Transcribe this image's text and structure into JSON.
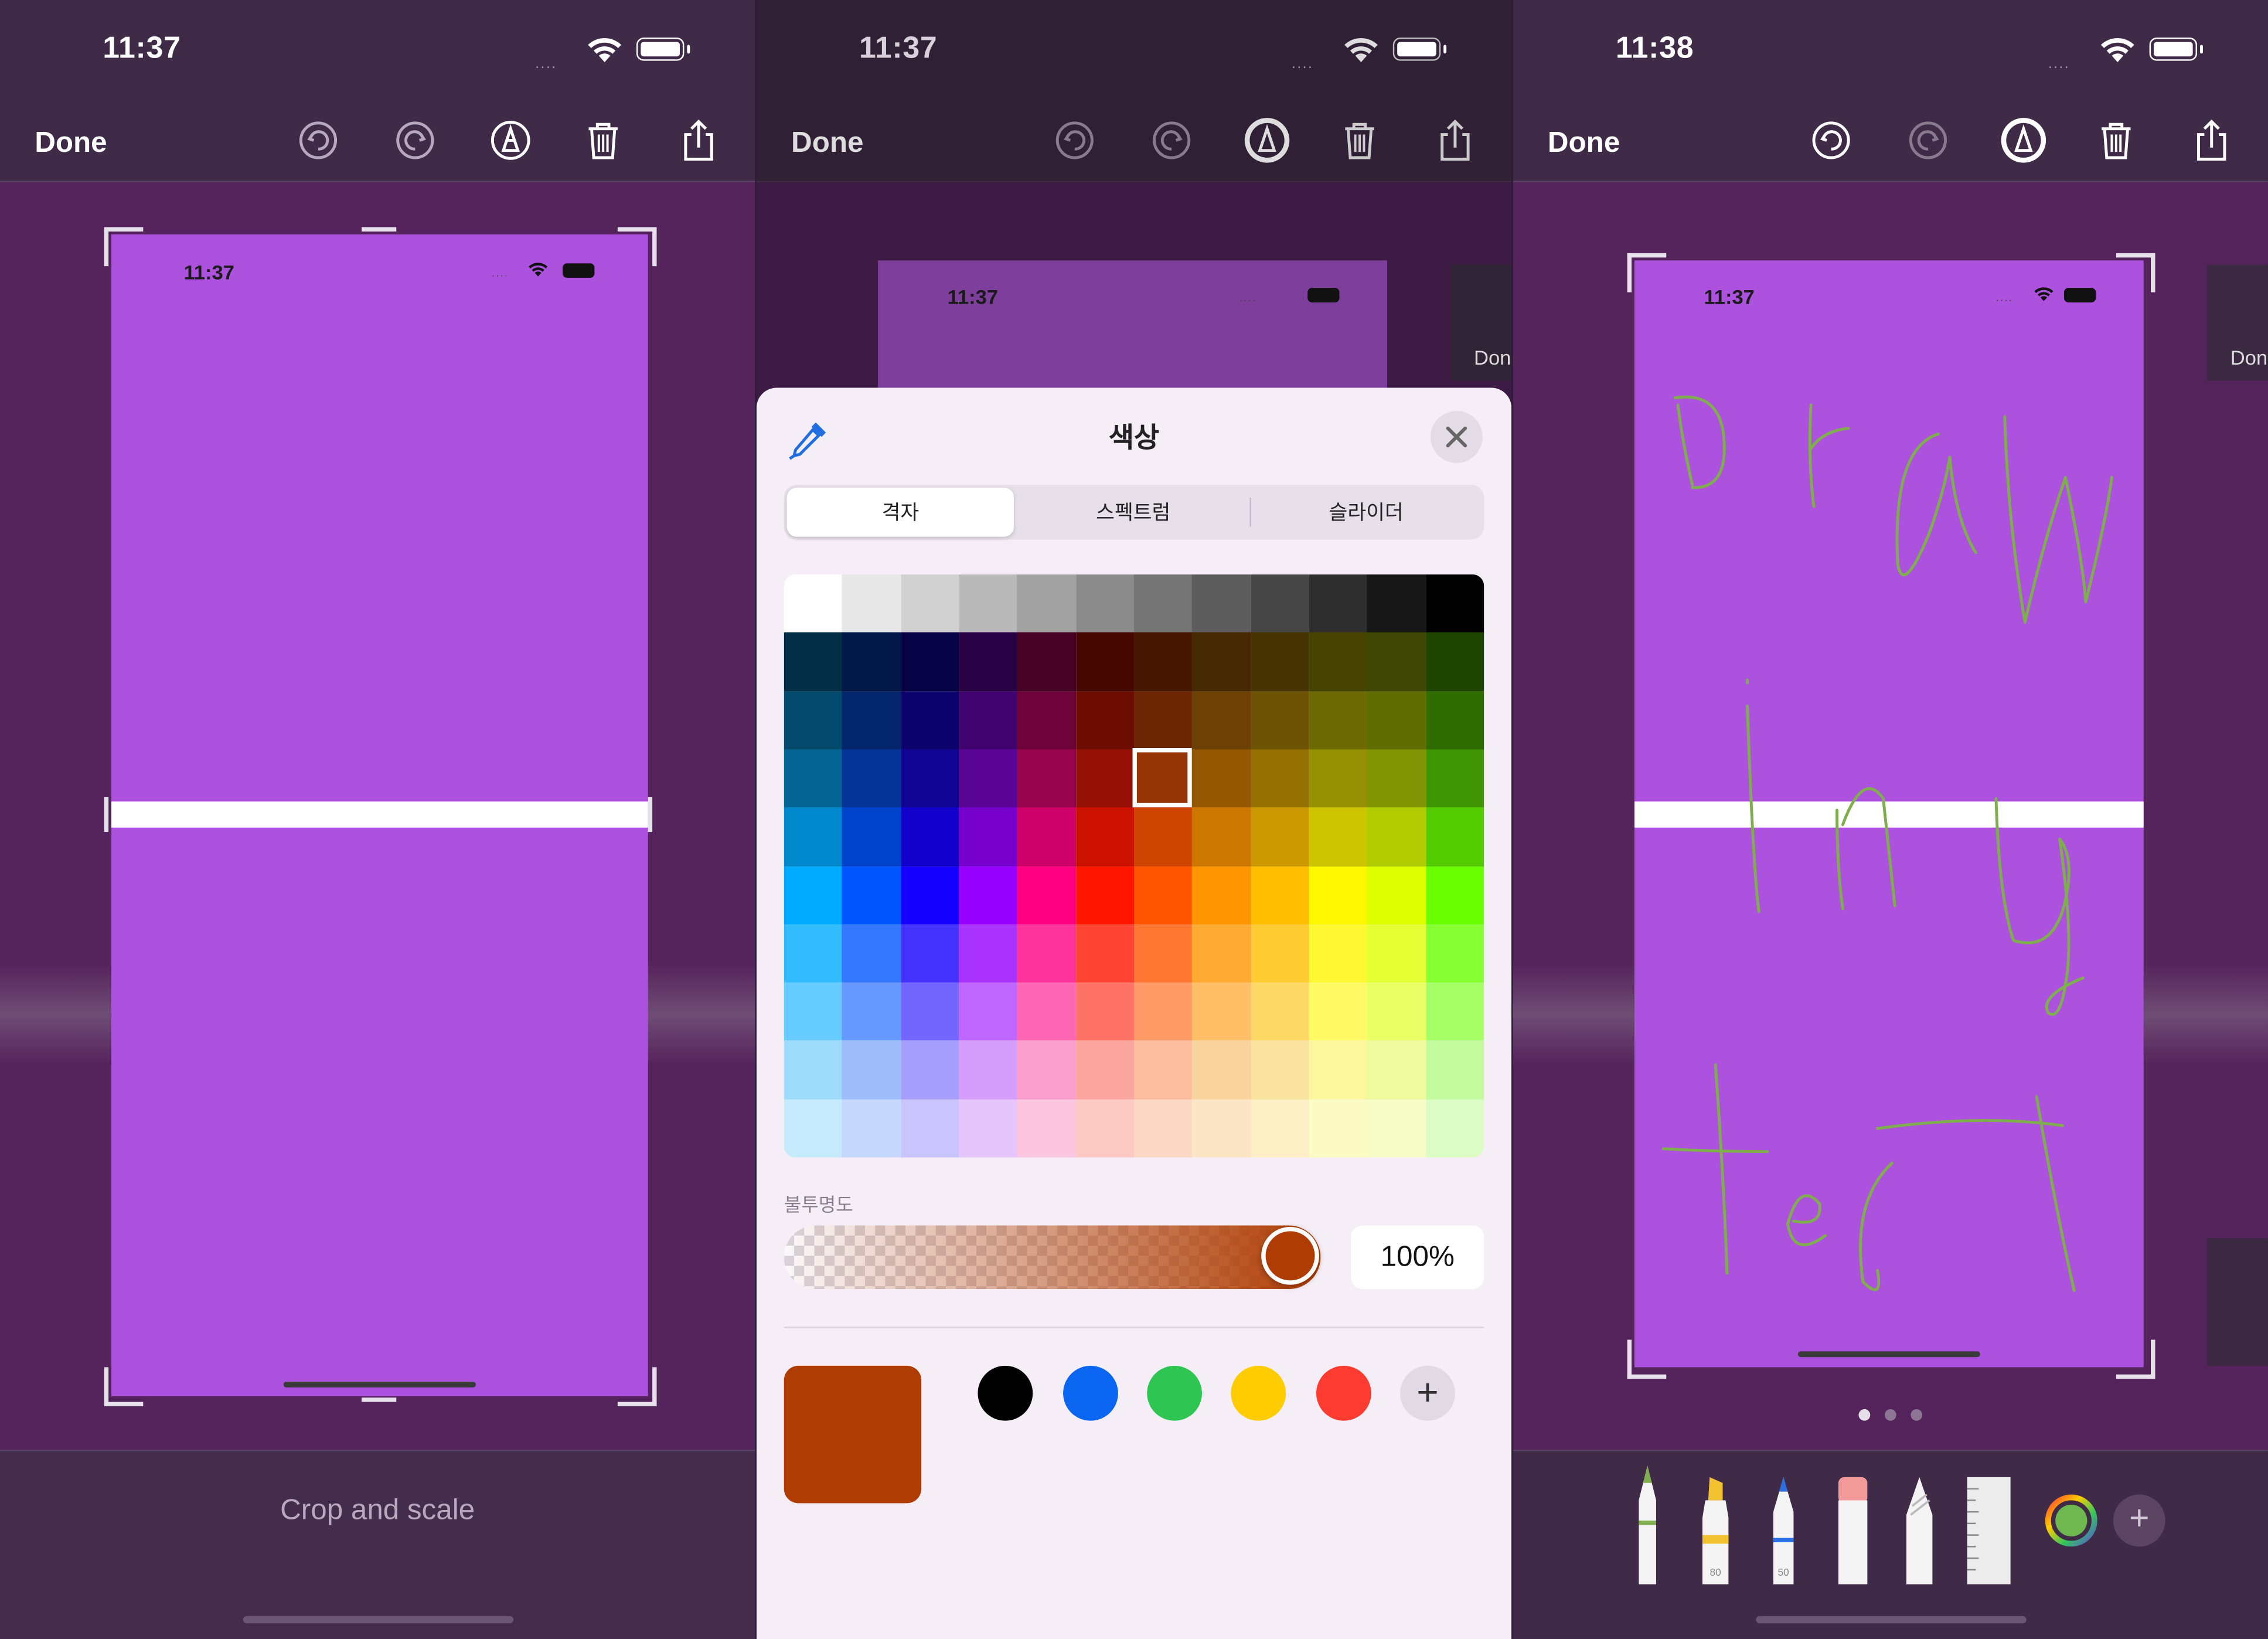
{
  "colors": {
    "accent_purple": "#ad52de",
    "selected_color": "#af3c02",
    "ink_green": "#7fae4f"
  },
  "panels": [
    {
      "status": {
        "time": "11:37",
        "signal": "....",
        "wifi_icon": "wifi-icon",
        "battery_icon": "battery-icon"
      },
      "nav": {
        "done_label": "Done",
        "icons": [
          "undo-icon",
          "redo-icon",
          "markup-pen-icon",
          "trash-icon",
          "share-icon"
        ]
      },
      "screenshot": {
        "time": "11:37",
        "signal": "...."
      },
      "bottom": {
        "label": "Crop and scale"
      }
    },
    {
      "status": {
        "time": "11:37",
        "signal": "....",
        "wifi_icon": "wifi-icon",
        "battery_icon": "battery-icon"
      },
      "nav": {
        "done_label": "Done",
        "icons": [
          "undo-icon",
          "redo-icon",
          "markup-pen-icon",
          "trash-icon",
          "share-icon"
        ]
      },
      "screenshot": {
        "time": "11:37",
        "signal": "...."
      },
      "ghost_label": "Don",
      "picker": {
        "title": "색상",
        "tabs": [
          "격자",
          "스펙트럼",
          "슬라이더"
        ],
        "selected_tab": "격자",
        "opacity_label": "불투명도",
        "opacity_value": "100%",
        "current_color": "#af3c02",
        "recent_colors": [
          "#000000",
          "#0a66f0",
          "#2fc553",
          "#fecc00",
          "#fe3b30"
        ],
        "add_label": "+"
      }
    },
    {
      "status": {
        "time": "11:38",
        "signal": "....",
        "wifi_icon": "wifi-icon",
        "battery_icon": "battery-icon"
      },
      "nav": {
        "done_label": "Done",
        "icons": [
          "undo-icon",
          "redo-icon",
          "markup-pen-icon",
          "trash-icon",
          "share-icon"
        ]
      },
      "screenshot": {
        "time": "11:37",
        "signal": "...."
      },
      "ghost_label": "Don",
      "drawing_text": "Drawing test",
      "page_dots": 3,
      "tools": [
        "pen-tool",
        "marker-tool",
        "pencil-tool",
        "eraser-tool",
        "lasso-tool",
        "ruler-tool",
        "color-wheel",
        "add-tool"
      ],
      "tool_labels": {
        "marker": "80",
        "pencil": "50"
      },
      "add_label": "+"
    }
  ]
}
